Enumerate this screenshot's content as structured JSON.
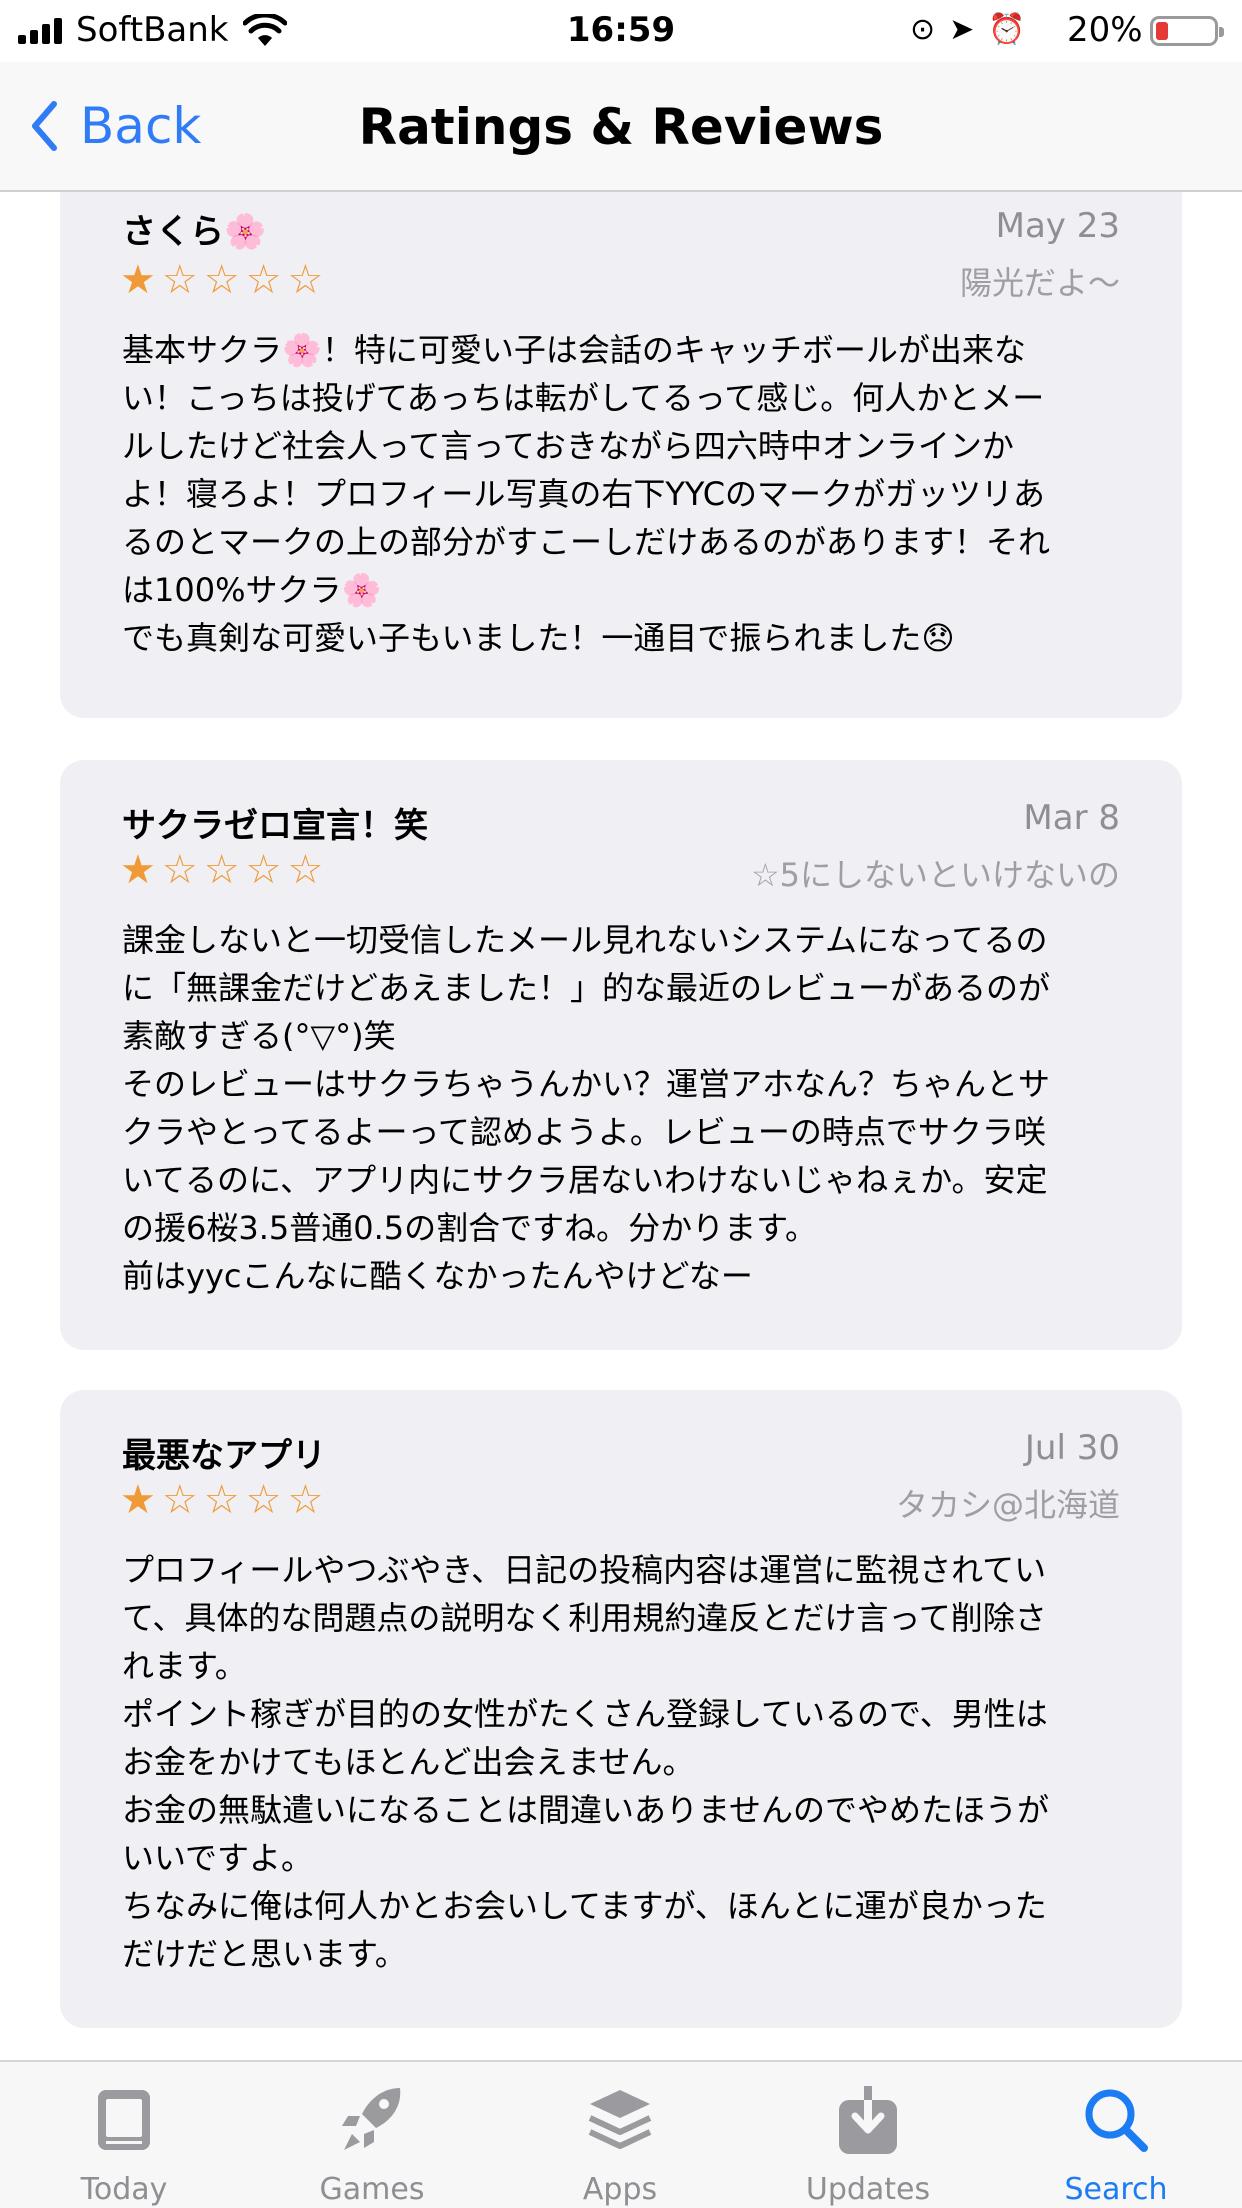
{
  "status_bar": {
    "carrier": "SoftBank",
    "time": "16:59",
    "battery": "20%"
  },
  "nav": {
    "back_label": "Back",
    "title": "Ratings & Reviews"
  },
  "reviews": [
    {
      "title": "さくら🌸",
      "date": "May 23",
      "author": "陽光だよ〜",
      "rating": 1,
      "body": "基本サクラ🌸！特に可愛い子は会話のキャッチボールが出来な\nい！こっちは投げてあっちは転がしてるって感じ。何人かとメー\nルしたけど社会人って言っておきながら四六時中オンラインか\nよ！寝ろよ！プロフィール写真の右下YYCのマークがガッツリあ\nるのとマークの上の部分がすこーしだけあるのがあります！それ\nは100%サクラ🌸\nでも真剣な可愛い子もいました！一通目で振られました😞"
    },
    {
      "title": "サクラゼロ宣言！笑",
      "date": "Mar 8",
      "author": "☆5にしないといけないの",
      "rating": 1,
      "body": "課金しないと一切受信したメール見れないシステムになってるの\nに「無課金だけどあえました！」的な最近のレビューがあるのが\n素敵すぎる(°▽°)笑\nそのレビューはサクラちゃうんかい？運営アホなん？ちゃんとサ\nクラやとってるよーって認めようよ。レビューの時点でサクラ咲\nいてるのに、アプリ内にサクラ居ないわけないじゃねぇか。安定\nの援6桜3.5普通0.5の割合ですね。分かります。\n前はyycこんなに酷くなかったんやけどなー"
    },
    {
      "title": "最悪なアプリ",
      "date": "Jul 30",
      "author": "タカシ@北海道",
      "rating": 1,
      "body": "プロフィールやつぶやき、日記の投稿内容は運営に監視されてい\nて、具体的な問題点の説明なく利用規約違反とだけ言って削除さ\nれます。\nポイント稼ぎが目的の女性がたくさん登録しているので、男性は\nお金をかけてもほとんど出会えません。\nお金の無駄遣いになることは間違いありませんのでやめたほうが\nいいですよ。\nちなみに俺は何人かとお会いしてますが、ほんとに運が良かった\nだけだと思います。"
    }
  ],
  "tabs": [
    {
      "label": "Today",
      "icon": "today-icon"
    },
    {
      "label": "Games",
      "icon": "rocket-icon"
    },
    {
      "label": "Apps",
      "icon": "layers-icon"
    },
    {
      "label": "Updates",
      "icon": "download-icon"
    },
    {
      "label": "Search",
      "icon": "search-icon",
      "active": true
    }
  ],
  "colors": {
    "accent": "#2f7cf6",
    "star": "#f09a37",
    "card": "#efeff4",
    "muted": "#8e8e93"
  }
}
